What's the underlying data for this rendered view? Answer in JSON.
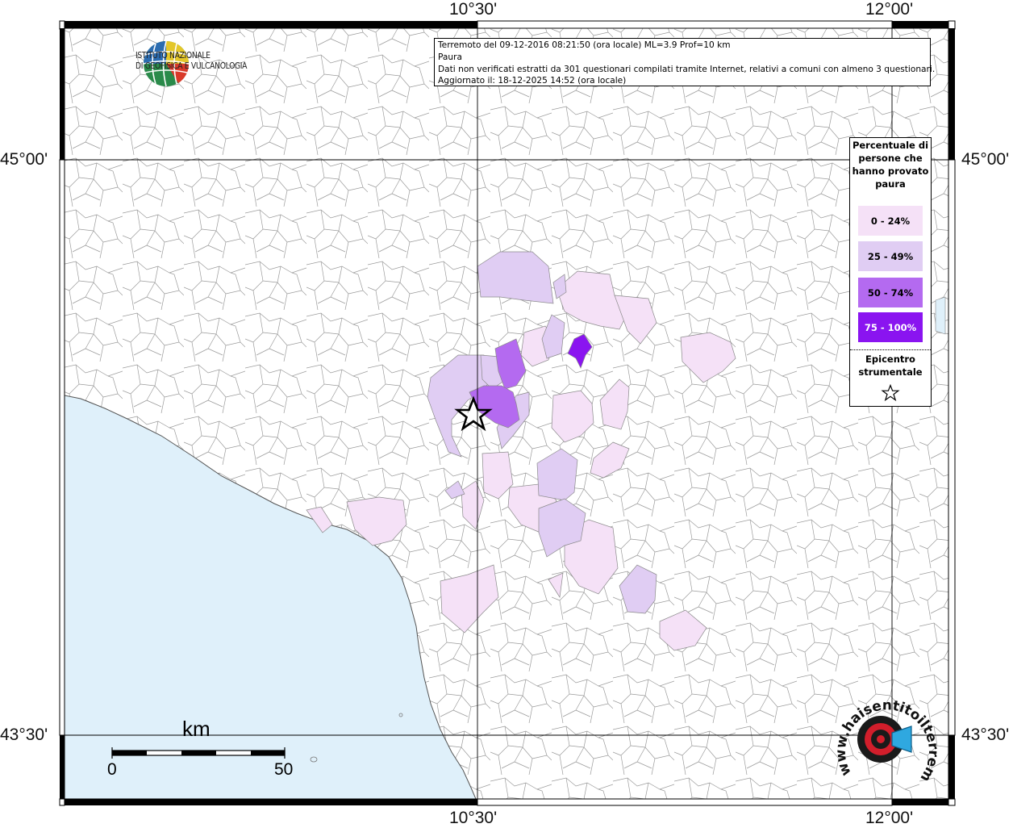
{
  "info": {
    "line1": "Terremoto del 09-12-2016 08:21:50 (ora locale) ML=3.9 Prof=10 km",
    "line2": "Paura",
    "line3": "Dati non verificati estratti da 301 questionari compilati tramite Internet, relativi a comuni con almeno 3 questionari.",
    "line4": "Aggiornato il: 18-12-2025 14:52 (ora locale)"
  },
  "logo": {
    "line1": "ISTITUTO NAZIONALE",
    "line2": "DI GEOFISICA E VULCANOLOGIA"
  },
  "axes": {
    "top_left_lon": "10°30'",
    "top_right_lon": "12°00'",
    "bottom_left_lon": "10°30'",
    "bottom_right_lon": "12°00'",
    "left_upper_lat": "45°00'",
    "left_lower_lat": "43°30'",
    "right_upper_lat": "45°00'",
    "right_lower_lat": "43°30'"
  },
  "legend": {
    "title": "Percentuale di persone che hanno provato paura",
    "classes": [
      {
        "label": "0 - 24%",
        "color": "#f5e1f7",
        "text_color": "#000000"
      },
      {
        "label": "25 - 49%",
        "color": "#e0cdf3",
        "text_color": "#000000"
      },
      {
        "label": "50 - 74%",
        "color": "#b46af0",
        "text_color": "#000000"
      },
      {
        "label": "75 - 100%",
        "color": "#8a14f0",
        "text_color": "#ffffff"
      }
    ],
    "epicenter_label": "Epicentro strumentale"
  },
  "scale": {
    "unit": "km",
    "min_label": "0",
    "max_label": "50"
  },
  "watermark": {
    "text": "www.haisentitoilterremoto.it"
  },
  "colors": {
    "sea": "#dff0fa",
    "boundary": "#8a8a8a"
  }
}
